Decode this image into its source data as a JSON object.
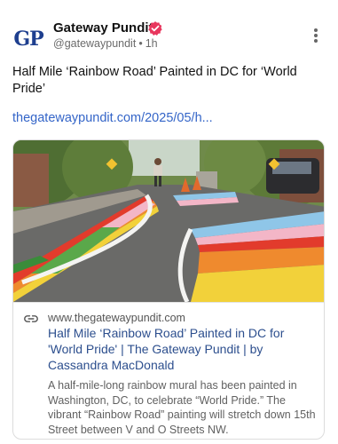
{
  "author": {
    "avatar_text": "GP",
    "display_name": "Gateway Pundit",
    "handle": "@gatewaypundit",
    "time": "1h"
  },
  "post": {
    "text": "Half Mile ‘Rainbow Road’ Painted in DC for ‘World Pride’",
    "link_text": "thegatewaypundit.com/2025/05/h..."
  },
  "card": {
    "domain": "www.thegatewaypundit.com",
    "title": "Half Mile ‘Rainbow Road’ Painted in DC for 'World Pride' | The Gateway Pundit | by Cassandra MacDonald",
    "description": "A half-mile-long rainbow mural has been painted in Washington, DC, to celebrate “World Pride.” The vibrant “Rainbow Road” painting will stretch down 15th Street between V and O Streets NW."
  },
  "icons": {
    "verified": "verified-badge-icon",
    "more": "more-options-icon",
    "link": "link-icon"
  },
  "colors": {
    "brand_blue": "#1e3f8f",
    "verified_pink": "#e8365d",
    "link_blue": "#3465c8",
    "card_title_blue": "#2d4f8e"
  }
}
